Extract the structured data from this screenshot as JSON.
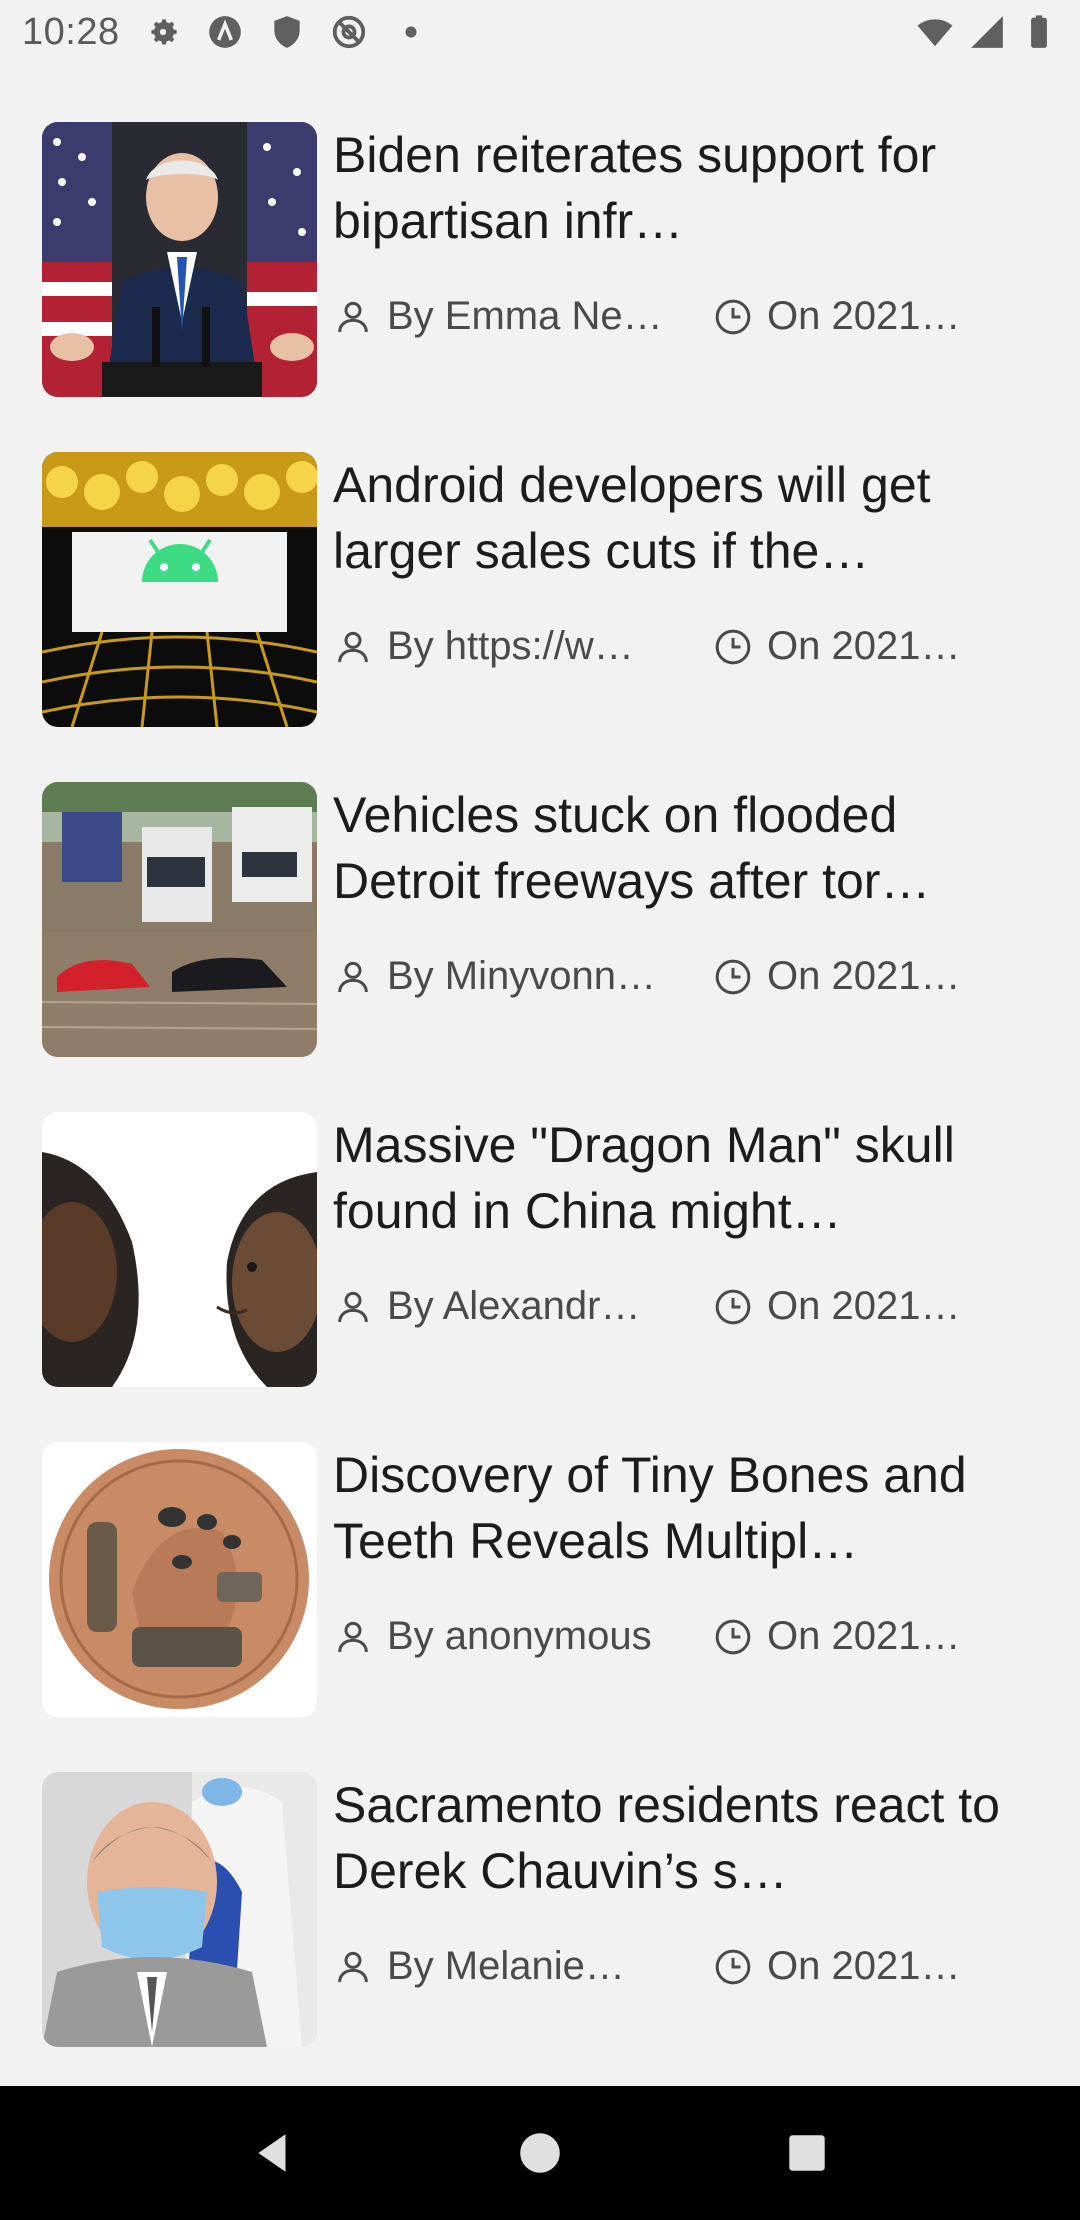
{
  "status_bar": {
    "time": "10:28",
    "icons_left": [
      "gear-icon",
      "app-a-icon",
      "shield-icon",
      "at-icon",
      "dot-icon"
    ],
    "icons_right": [
      "wifi-icon",
      "signal-icon",
      "battery-icon"
    ]
  },
  "articles": [
    {
      "title": "Biden reiterates support for bipartisan infr…",
      "author": "By Emma Ne…",
      "date": "On 2021…",
      "image": "biden-podium"
    },
    {
      "title": "Android developers will get larger sales cuts if the…",
      "author": "By https://w…",
      "date": "On 2021…",
      "image": "android-logo"
    },
    {
      "title": "Vehicles stuck on flooded Detroit freeways after tor…",
      "author": "By Minyvonn…",
      "date": "On 2021…",
      "image": "flooded-freeway"
    },
    {
      "title": "Massive \"Dragon Man\" skull found in China might…",
      "author": "By Alexandr…",
      "date": "On 2021…",
      "image": "dragon-man-reconstruction"
    },
    {
      "title": "Discovery of Tiny Bones and Teeth Reveals Multipl…",
      "author": "By anonymous",
      "date": "On 2021…",
      "image": "penny-fossils"
    },
    {
      "title": "Sacramento residents react to Derek Chauvin’s s…",
      "author": "By Melanie…",
      "date": "On 2021…",
      "image": "chauvin-masked"
    }
  ],
  "nav_bar": {
    "back": "back-icon",
    "home": "home-icon",
    "recents": "recents-icon"
  }
}
